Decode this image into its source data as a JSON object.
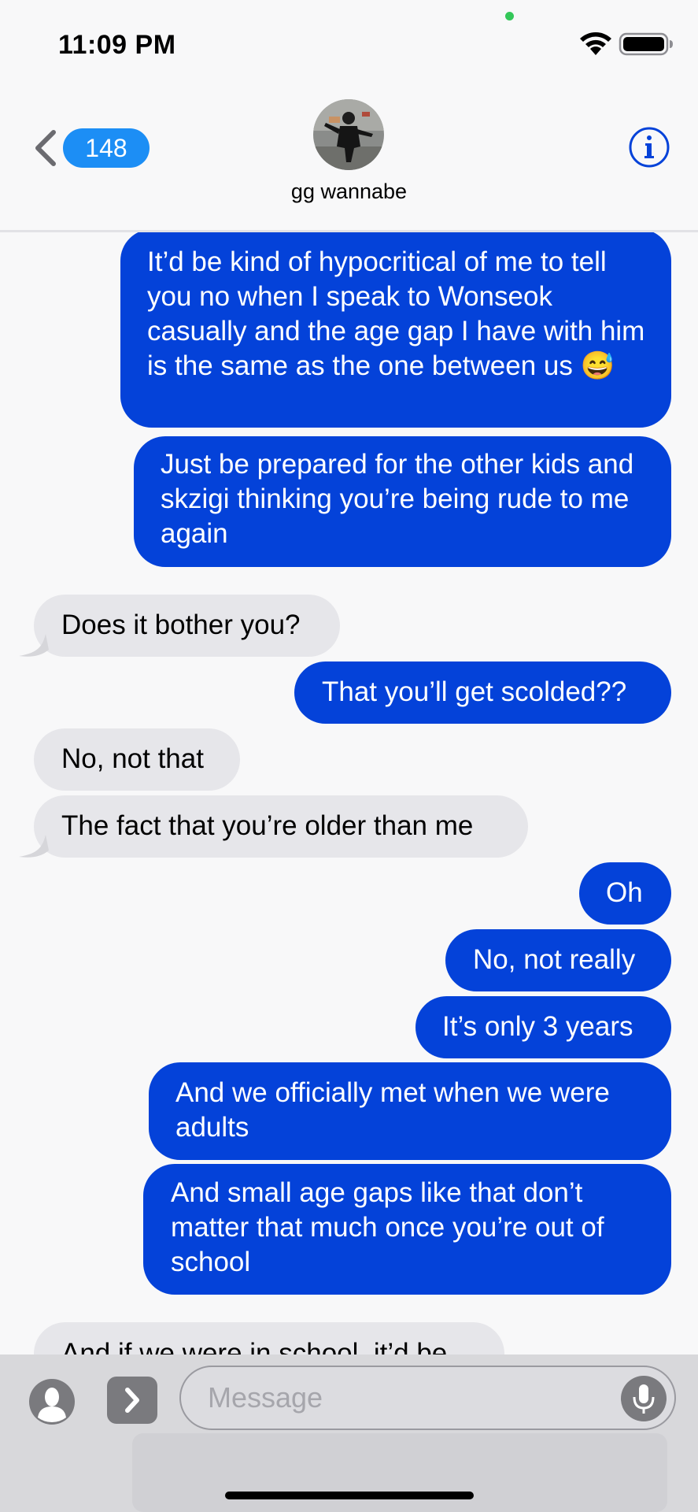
{
  "status_bar": {
    "time": "11:09 PM",
    "wifi_icon": "wifi-icon",
    "battery_icon": "battery-full-icon"
  },
  "header": {
    "back_icon": "chevron-left-icon",
    "unread_count": "148",
    "contact_name": "gg wannabe",
    "info_icon": "info-icon"
  },
  "messages": [
    {
      "side": "sent",
      "text": "It’d be kind of hypocritical of me to tell you no when I speak to Wonseok casually and the age gap I have with him is the same as the one between us 😅"
    },
    {
      "side": "sent",
      "text": "Just be prepared for the other kids and skzigi thinking you’re being rude to me again"
    },
    {
      "side": "received",
      "text": "Does it bother you?"
    },
    {
      "side": "sent",
      "text": "That you’ll get scolded??"
    },
    {
      "side": "received",
      "text": "No, not that"
    },
    {
      "side": "received",
      "text": "The fact that you’re older than me"
    },
    {
      "side": "sent",
      "text": "Oh"
    },
    {
      "side": "sent",
      "text": "No, not really"
    },
    {
      "side": "sent",
      "text": "It’s only 3 years"
    },
    {
      "side": "sent",
      "text": "And we officially met when we were adults"
    },
    {
      "side": "sent",
      "text": "And small age gaps like that don’t matter that much once you’re out of school"
    },
    {
      "side": "received",
      "text": "And if we were in school, it’d be"
    }
  ],
  "input_bar": {
    "placeholder": "Message",
    "contact_icon": "contact-card-icon",
    "apps_icon": "chevron-right-icon",
    "mic_icon": "microphone-icon"
  },
  "colors": {
    "sent_bubble": "#0442d9",
    "received_bubble": "#e6e6ea",
    "badge": "#1c8ef5",
    "accent": "#0442d9"
  }
}
